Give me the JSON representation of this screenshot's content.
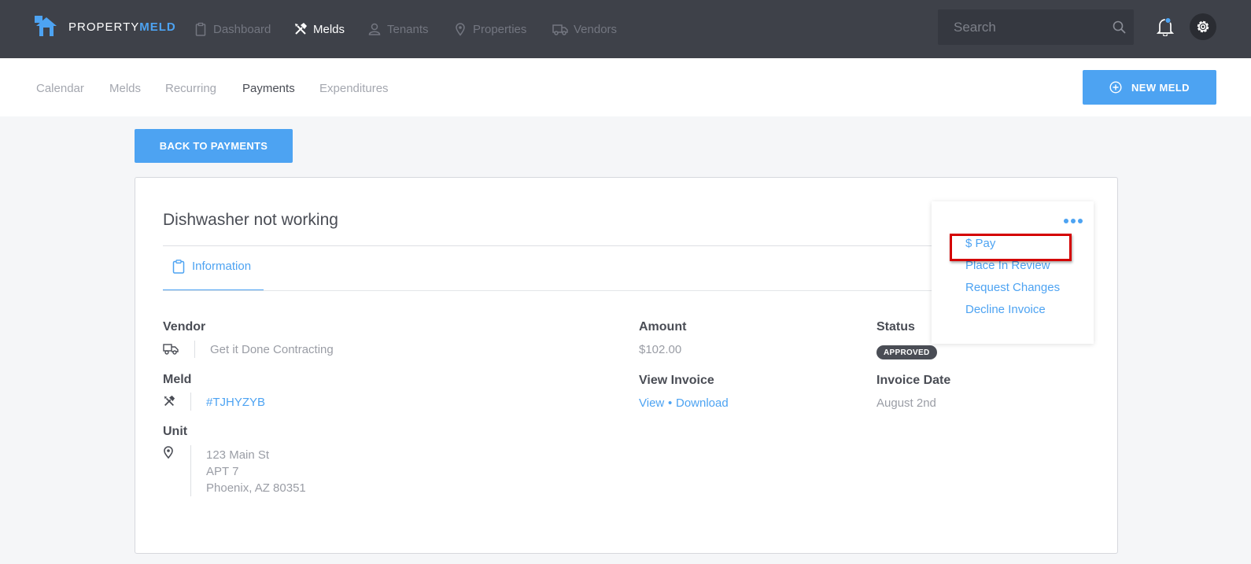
{
  "brand": {
    "name_light": "PROPERTY",
    "name_bold": "MELD"
  },
  "nav": [
    {
      "label": "Dashboard",
      "icon": "clipboard-icon"
    },
    {
      "label": "Melds",
      "icon": "tools-icon",
      "active": true
    },
    {
      "label": "Tenants",
      "icon": "person-icon"
    },
    {
      "label": "Properties",
      "icon": "map-pin-icon"
    },
    {
      "label": "Vendors",
      "icon": "truck-icon"
    }
  ],
  "search": {
    "placeholder": "Search"
  },
  "subnav": [
    {
      "label": "Calendar"
    },
    {
      "label": "Melds"
    },
    {
      "label": "Recurring"
    },
    {
      "label": "Payments",
      "active": true
    },
    {
      "label": "Expenditures"
    }
  ],
  "new_meld": {
    "label": "NEW MELD"
  },
  "back_button": {
    "label": "BACK TO PAYMENTS"
  },
  "invoice": {
    "title": "Dishwasher not working",
    "tab_label": "Information",
    "vendor_label": "Vendor",
    "vendor_name": "Get it Done Contracting",
    "meld_label": "Meld",
    "meld_id": "#TJHYZYB",
    "unit_label": "Unit",
    "unit_line1": "123 Main St",
    "unit_line2": "APT 7",
    "unit_line3": "Phoenix, AZ 80351",
    "amount_label": "Amount",
    "amount_value": "$102.00",
    "view_invoice_label": "View Invoice",
    "view_link": "View",
    "separator": "•",
    "download_link": "Download",
    "status_label": "Status",
    "status_value": "APPROVED",
    "invoice_date_label": "Invoice Date",
    "invoice_date_value": "August 2nd"
  },
  "actions_menu": {
    "items": [
      "$ Pay",
      "Place In Review",
      "Request Changes",
      "Decline Invoice"
    ]
  },
  "colors": {
    "topbar": "#3e4149",
    "accent": "#4da3f2",
    "highlight": "#d40000",
    "badge": "#4a4d55"
  }
}
